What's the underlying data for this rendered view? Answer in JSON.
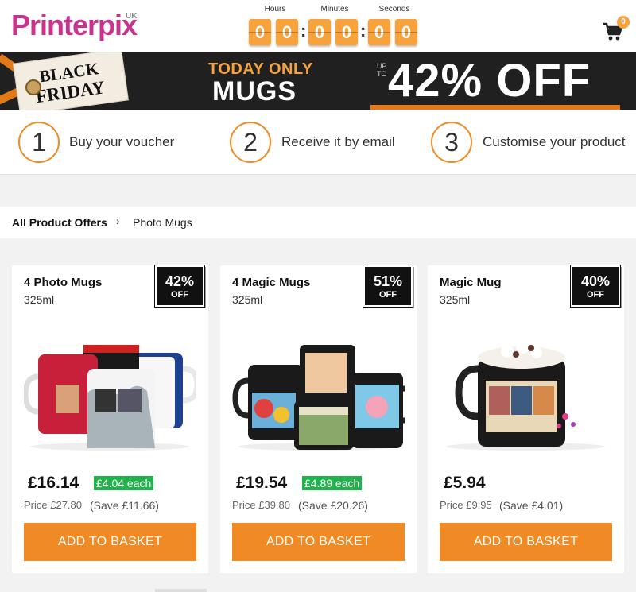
{
  "brand": {
    "name": "Printerpix",
    "region": "UK"
  },
  "countdown": {
    "labels": [
      "Hours",
      "Minutes",
      "Seconds"
    ],
    "digits": [
      "0",
      "0",
      "0",
      "0",
      "0",
      "0"
    ],
    "separator": ":"
  },
  "cart": {
    "count": "0"
  },
  "banner": {
    "tag_line1": "BLACK",
    "tag_line2": "FRIDAY",
    "today_only": "TODAY ONLY",
    "product": "MUGS",
    "up_to_1": "UP",
    "up_to_2": "TO",
    "discount": "42% OFF"
  },
  "steps": [
    {
      "number": "1",
      "text": "Buy your voucher"
    },
    {
      "number": "2",
      "text": "Receive it by email"
    },
    {
      "number": "3",
      "text": "Customise your product"
    }
  ],
  "breadcrumb": {
    "parent": "All Product Offers",
    "separator": "›",
    "current": "Photo Mugs"
  },
  "products": [
    {
      "title": "4 Photo Mugs",
      "size": "325ml",
      "badge_pct": "42%",
      "badge_off": "OFF",
      "price": "£16.14",
      "each": "£4.04 each",
      "was": "Price £27.80",
      "save": "(Save £11.66)",
      "button": "ADD TO BASKET"
    },
    {
      "title": "4 Magic Mugs",
      "size": "325ml",
      "badge_pct": "51%",
      "badge_off": "OFF",
      "price": "£19.54",
      "each": "£4.89 each",
      "was": "Price £39.80",
      "save": "(Save £20.26)",
      "button": "ADD TO BASKET"
    },
    {
      "title": "Magic Mug",
      "size": "325ml",
      "badge_pct": "40%",
      "badge_off": "OFF",
      "price": "£5.94",
      "each": "",
      "was": "Price £9.95",
      "save": "(Save £4.01)",
      "button": "ADD TO BASKET"
    }
  ],
  "colors": {
    "brand": "#c8338c",
    "accent": "#f08a24",
    "each_badge": "#22b24c"
  },
  "icons": {
    "cart": "shopping-cart-icon",
    "chevron": "chevron-right-icon"
  }
}
